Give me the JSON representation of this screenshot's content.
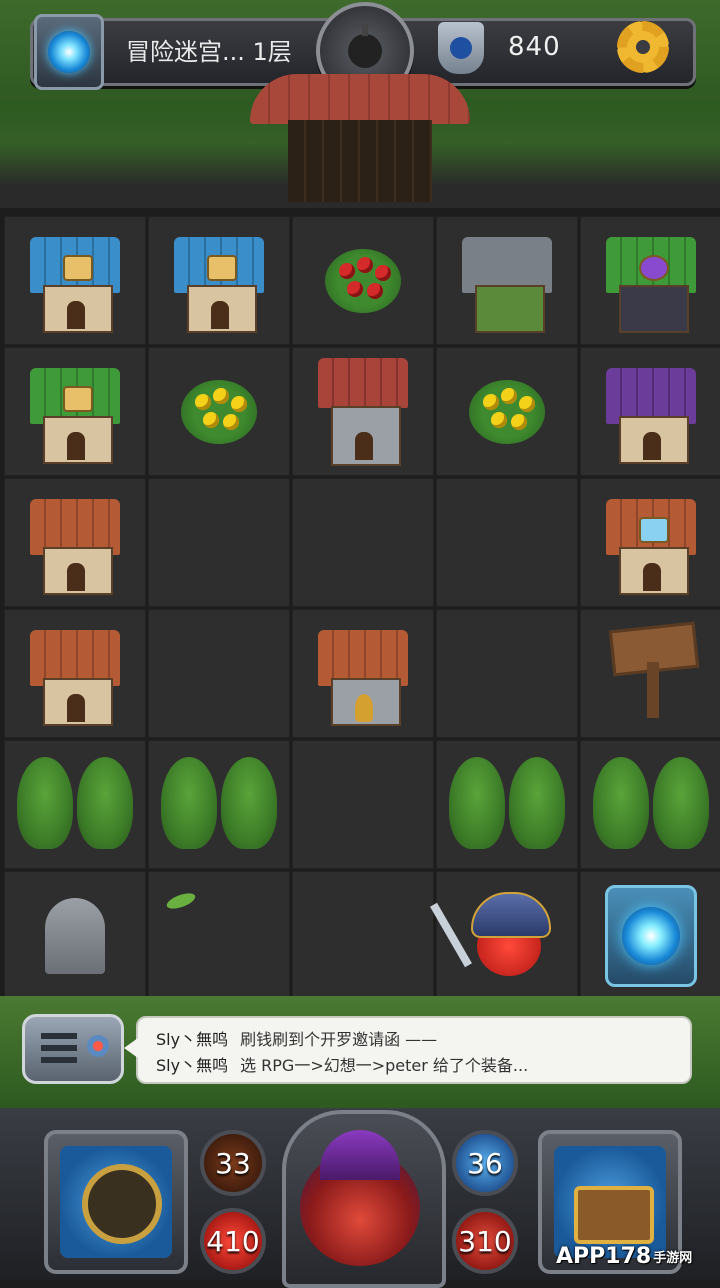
{
  "top_bar": {
    "level_text": "冒险迷宫... 1层",
    "gold": "840",
    "icons": [
      "portal-icon",
      "bomb-icon",
      "shield-icon",
      "gear-icon"
    ]
  },
  "grid": [
    [
      "house-blue-shield",
      "house-blue-swords",
      "red-flower-bush",
      "stone-arena",
      "wizard-tower-green"
    ],
    [
      "house-green-gem",
      "yellow-flower-bush",
      "church",
      "yellow-flower-bush",
      "wizard-tower-purple"
    ],
    [
      "house-brown",
      "empty",
      "empty",
      "empty",
      "house-brown-sign"
    ],
    [
      "workshop",
      "empty",
      "bell-shrine",
      "empty",
      "wooden-signpost"
    ],
    [
      "trees",
      "trees",
      "empty",
      "trees",
      "trees"
    ],
    [
      "tombstone",
      "empty-sprout",
      "empty",
      "hero-player",
      "blue-portal"
    ]
  ],
  "chat": {
    "messages": [
      {
        "user": "Sly丶無鸣",
        "text": "刷钱刷到个开罗邀请函 ——"
      },
      {
        "user": "Sly丶無鸣",
        "text": "选 RPG一>幻想一>peter 给了个装备..."
      }
    ]
  },
  "stats": {
    "attack": "33",
    "hp": "410",
    "defense": "36",
    "mana": "310"
  },
  "watermark": {
    "brand": "APP178",
    "sub": "手游网"
  },
  "colors": {
    "grass": "#3e6a2c",
    "tile": "#2e2e2e",
    "frame": "#7c8088",
    "gold_gear": "#e0a020"
  }
}
